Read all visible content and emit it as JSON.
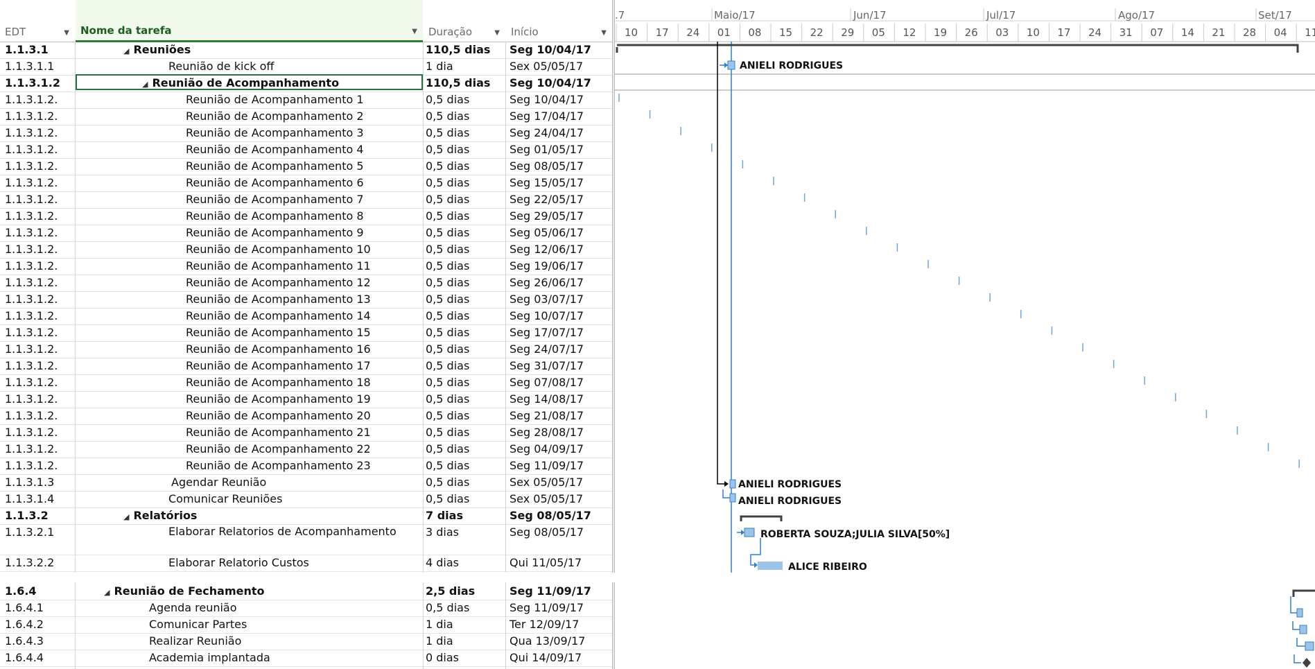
{
  "headers": {
    "edt": "EDT",
    "nome": "Nome da tarefa",
    "duracao": "Duração",
    "inicio": "Início"
  },
  "timeline": {
    "months": [
      {
        "label": ".7"
      },
      {
        "label": "Maio/17"
      },
      {
        "label": "Jun/17"
      },
      {
        "label": "Jul/17"
      },
      {
        "label": "Ago/17"
      },
      {
        "label": "Set/17"
      }
    ],
    "weeks": [
      "10",
      "17",
      "24",
      "01",
      "08",
      "15",
      "22",
      "29",
      "05",
      "12",
      "19",
      "26",
      "03",
      "10",
      "17",
      "24",
      "31",
      "07",
      "14",
      "21",
      "28",
      "04",
      "11"
    ]
  },
  "tasks": [
    {
      "edt": "1.1.3.1",
      "nome": "Reuniões",
      "dur": "110,5 dias",
      "ini": "Seg 10/04/17",
      "indent": 195,
      "summary": true,
      "bold": true
    },
    {
      "edt": "1.1.3.1.1",
      "nome": "Reunião de kick off",
      "dur": "1 dia",
      "ini": "Sex 05/05/17",
      "indent": 243
    },
    {
      "edt": "1.1.3.1.2",
      "nome": "Reunião de Acompanhamento",
      "dur": "110,5 dias",
      "ini": "Seg 10/04/17",
      "indent": 222,
      "summary": true,
      "bold": true
    },
    {
      "edt": "1.1.3.1.2.",
      "nome": "Reunião de Acompanhamento 1",
      "dur": "0,5 dias",
      "ini": "Seg 10/04/17",
      "indent": 268
    },
    {
      "edt": "1.1.3.1.2.",
      "nome": "Reunião de Acompanhamento 2",
      "dur": "0,5 dias",
      "ini": "Seg 17/04/17",
      "indent": 268
    },
    {
      "edt": "1.1.3.1.2.",
      "nome": "Reunião de Acompanhamento 3",
      "dur": "0,5 dias",
      "ini": "Seg 24/04/17",
      "indent": 268
    },
    {
      "edt": "1.1.3.1.2.",
      "nome": "Reunião de Acompanhamento 4",
      "dur": "0,5 dias",
      "ini": "Seg 01/05/17",
      "indent": 268
    },
    {
      "edt": "1.1.3.1.2.",
      "nome": "Reunião de Acompanhamento 5",
      "dur": "0,5 dias",
      "ini": "Seg 08/05/17",
      "indent": 268
    },
    {
      "edt": "1.1.3.1.2.",
      "nome": "Reunião de Acompanhamento 6",
      "dur": "0,5 dias",
      "ini": "Seg 15/05/17",
      "indent": 268
    },
    {
      "edt": "1.1.3.1.2.",
      "nome": "Reunião de Acompanhamento 7",
      "dur": "0,5 dias",
      "ini": "Seg 22/05/17",
      "indent": 268
    },
    {
      "edt": "1.1.3.1.2.",
      "nome": "Reunião de Acompanhamento 8",
      "dur": "0,5 dias",
      "ini": "Seg 29/05/17",
      "indent": 268
    },
    {
      "edt": "1.1.3.1.2.",
      "nome": "Reunião de Acompanhamento 9",
      "dur": "0,5 dias",
      "ini": "Seg 05/06/17",
      "indent": 268
    },
    {
      "edt": "1.1.3.1.2.",
      "nome": "Reunião de Acompanhamento 10",
      "dur": "0,5 dias",
      "ini": "Seg 12/06/17",
      "indent": 268
    },
    {
      "edt": "1.1.3.1.2.",
      "nome": "Reunião de Acompanhamento 11",
      "dur": "0,5 dias",
      "ini": "Seg 19/06/17",
      "indent": 268
    },
    {
      "edt": "1.1.3.1.2.",
      "nome": "Reunião de Acompanhamento 12",
      "dur": "0,5 dias",
      "ini": "Seg 26/06/17",
      "indent": 268
    },
    {
      "edt": "1.1.3.1.2.",
      "nome": "Reunião de Acompanhamento 13",
      "dur": "0,5 dias",
      "ini": "Seg 03/07/17",
      "indent": 268
    },
    {
      "edt": "1.1.3.1.2.",
      "nome": "Reunião de Acompanhamento 14",
      "dur": "0,5 dias",
      "ini": "Seg 10/07/17",
      "indent": 268
    },
    {
      "edt": "1.1.3.1.2.",
      "nome": "Reunião de Acompanhamento 15",
      "dur": "0,5 dias",
      "ini": "Seg 17/07/17",
      "indent": 268
    },
    {
      "edt": "1.1.3.1.2.",
      "nome": "Reunião de Acompanhamento 16",
      "dur": "0,5 dias",
      "ini": "Seg 24/07/17",
      "indent": 268
    },
    {
      "edt": "1.1.3.1.2.",
      "nome": "Reunião de Acompanhamento 17",
      "dur": "0,5 dias",
      "ini": "Seg 31/07/17",
      "indent": 268
    },
    {
      "edt": "1.1.3.1.2.",
      "nome": "Reunião de Acompanhamento 18",
      "dur": "0,5 dias",
      "ini": "Seg 07/08/17",
      "indent": 268
    },
    {
      "edt": "1.1.3.1.2.",
      "nome": "Reunião de Acompanhamento 19",
      "dur": "0,5 dias",
      "ini": "Seg 14/08/17",
      "indent": 268
    },
    {
      "edt": "1.1.3.1.2.",
      "nome": "Reunião de Acompanhamento 20",
      "dur": "0,5 dias",
      "ini": "Seg 21/08/17",
      "indent": 268
    },
    {
      "edt": "1.1.3.1.2.",
      "nome": "Reunião de Acompanhamento 21",
      "dur": "0,5 dias",
      "ini": "Seg 28/08/17",
      "indent": 268
    },
    {
      "edt": "1.1.3.1.2.",
      "nome": "Reunião de Acompanhamento 22",
      "dur": "0,5 dias",
      "ini": "Seg 04/09/17",
      "indent": 268
    },
    {
      "edt": "1.1.3.1.2.",
      "nome": "Reunião de Acompanhamento 23",
      "dur": "0,5 dias",
      "ini": "Seg 11/09/17",
      "indent": 268
    },
    {
      "edt": "1.1.3.1.3",
      "nome": "Agendar Reunião",
      "dur": "0,5 dias",
      "ini": "Sex 05/05/17",
      "indent": 247
    },
    {
      "edt": "1.1.3.1.4",
      "nome": "Comunicar Reuniões",
      "dur": "0,5 dias",
      "ini": "Sex 05/05/17",
      "indent": 243
    },
    {
      "edt": "1.1.3.2",
      "nome": "Relatórios",
      "dur": "7 dias",
      "ini": "Seg 08/05/17",
      "indent": 195,
      "summary": true,
      "bold": true
    },
    {
      "edt": "1.1.3.2.1",
      "nome": "Elaborar Relatorios de Acompanhamento",
      "dur": "3 dias",
      "ini": "Seg 08/05/17",
      "indent": 243,
      "tall": true
    },
    {
      "edt": "1.1.3.2.2",
      "nome": "Elaborar Relatorio Custos",
      "dur": "4 dias",
      "ini": "Qui 11/05/17",
      "indent": 243
    },
    {
      "edt": "1.6.4",
      "nome": "Reunião de Fechamento",
      "dur": "2,5 dias",
      "ini": "Seg 11/09/17",
      "indent": 167,
      "summary": true,
      "bold": true
    },
    {
      "edt": "1.6.4.1",
      "nome": "Agenda reunião",
      "dur": "0,5 dias",
      "ini": "Seg 11/09/17",
      "indent": 215
    },
    {
      "edt": "1.6.4.2",
      "nome": "Comunicar Partes",
      "dur": "1 dia",
      "ini": "Ter 12/09/17",
      "indent": 215
    },
    {
      "edt": "1.6.4.3",
      "nome": "Realizar Reunião",
      "dur": "1 dia",
      "ini": "Qua 13/09/17",
      "indent": 215
    },
    {
      "edt": "1.6.4.4",
      "nome": "Academia implantada",
      "dur": "0 dias",
      "ini": "Qui 14/09/17",
      "indent": 215
    }
  ],
  "resources": {
    "kickoff": "ANIELI RODRIGUES",
    "agendar": "ANIELI RODRIGUES",
    "comunicar": "ANIELI RODRIGUES",
    "relatorios": "ROBERTA SOUZA;JULIA SILVA[50%]",
    "custos": "ALICE RIBEIRO"
  },
  "colors": {
    "task_bar": "#9dc3e6",
    "link": "#2f7fd1",
    "summary": "#404040",
    "grid_header_sel": "#217346"
  }
}
